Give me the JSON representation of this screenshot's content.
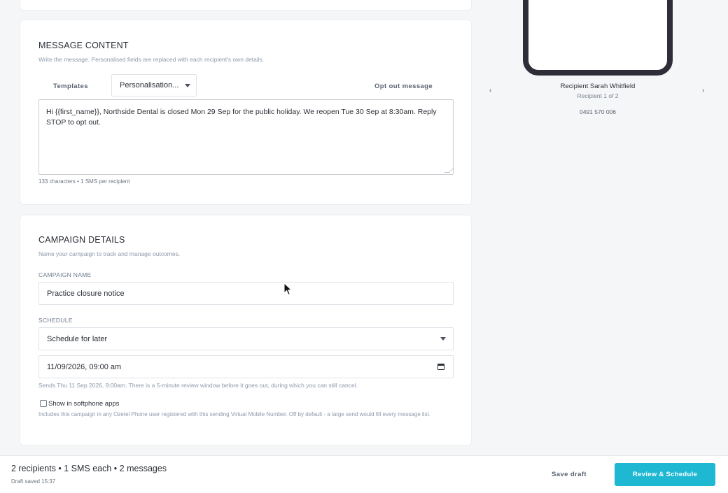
{
  "message_content": {
    "title": "MESSAGE CONTENT",
    "subtitle": "Write the message. Personalised fields are replaced with each recipient's own details.",
    "toolbar": {
      "templates_label": "Templates",
      "personalisation_label": "Personalisation...",
      "opt_out_label": "Opt out message"
    },
    "body_text": "Hi {{first_name}}, Northside Dental is closed Mon 29 Sep for the public holiday. We reopen Tue 30 Sep at 8:30am. Reply STOP to opt out.",
    "char_count": "133 characters • 1 SMS per recipient"
  },
  "campaign_details": {
    "title": "CAMPAIGN DETAILS",
    "subtitle": "Name your campaign to track and manage outcomes.",
    "name_label": "CAMPAIGN NAME",
    "name_value": "Practice closure notice",
    "schedule_label": "SCHEDULE",
    "schedule_value": "Schedule for later",
    "datetime_value": "11/09/2026, 09:00 am",
    "schedule_hint": "Sends Thu 11 Sep 2026, 9:00am. There is a 5-minute review window before it goes out, during which you can still cancel.",
    "softphone_label": "Show in softphone apps",
    "softphone_hint": "Includes this campaign in any Ozetel Phone user registered with this sending Virtual Mobile Number. Off by default - a large send would fill every message list.",
    "softphone_checked": false
  },
  "preview": {
    "recipient_name": "Recipient Sarah Whitfield",
    "recipient_index": "Recipient 1 of 2",
    "phone_number": "0491 570 006",
    "prev_glyph": "‹",
    "next_glyph": "›"
  },
  "bottom_bar": {
    "summary": "2 recipients • 1 SMS each • 2 messages",
    "draft_saved": "Draft saved 15:37",
    "save_draft_label": "Save draft",
    "primary_label": "Review & Schedule"
  },
  "colors": {
    "accent": "#1fb8d3",
    "phone_frame": "#2f2e38",
    "muted_text": "#8d9aab"
  }
}
